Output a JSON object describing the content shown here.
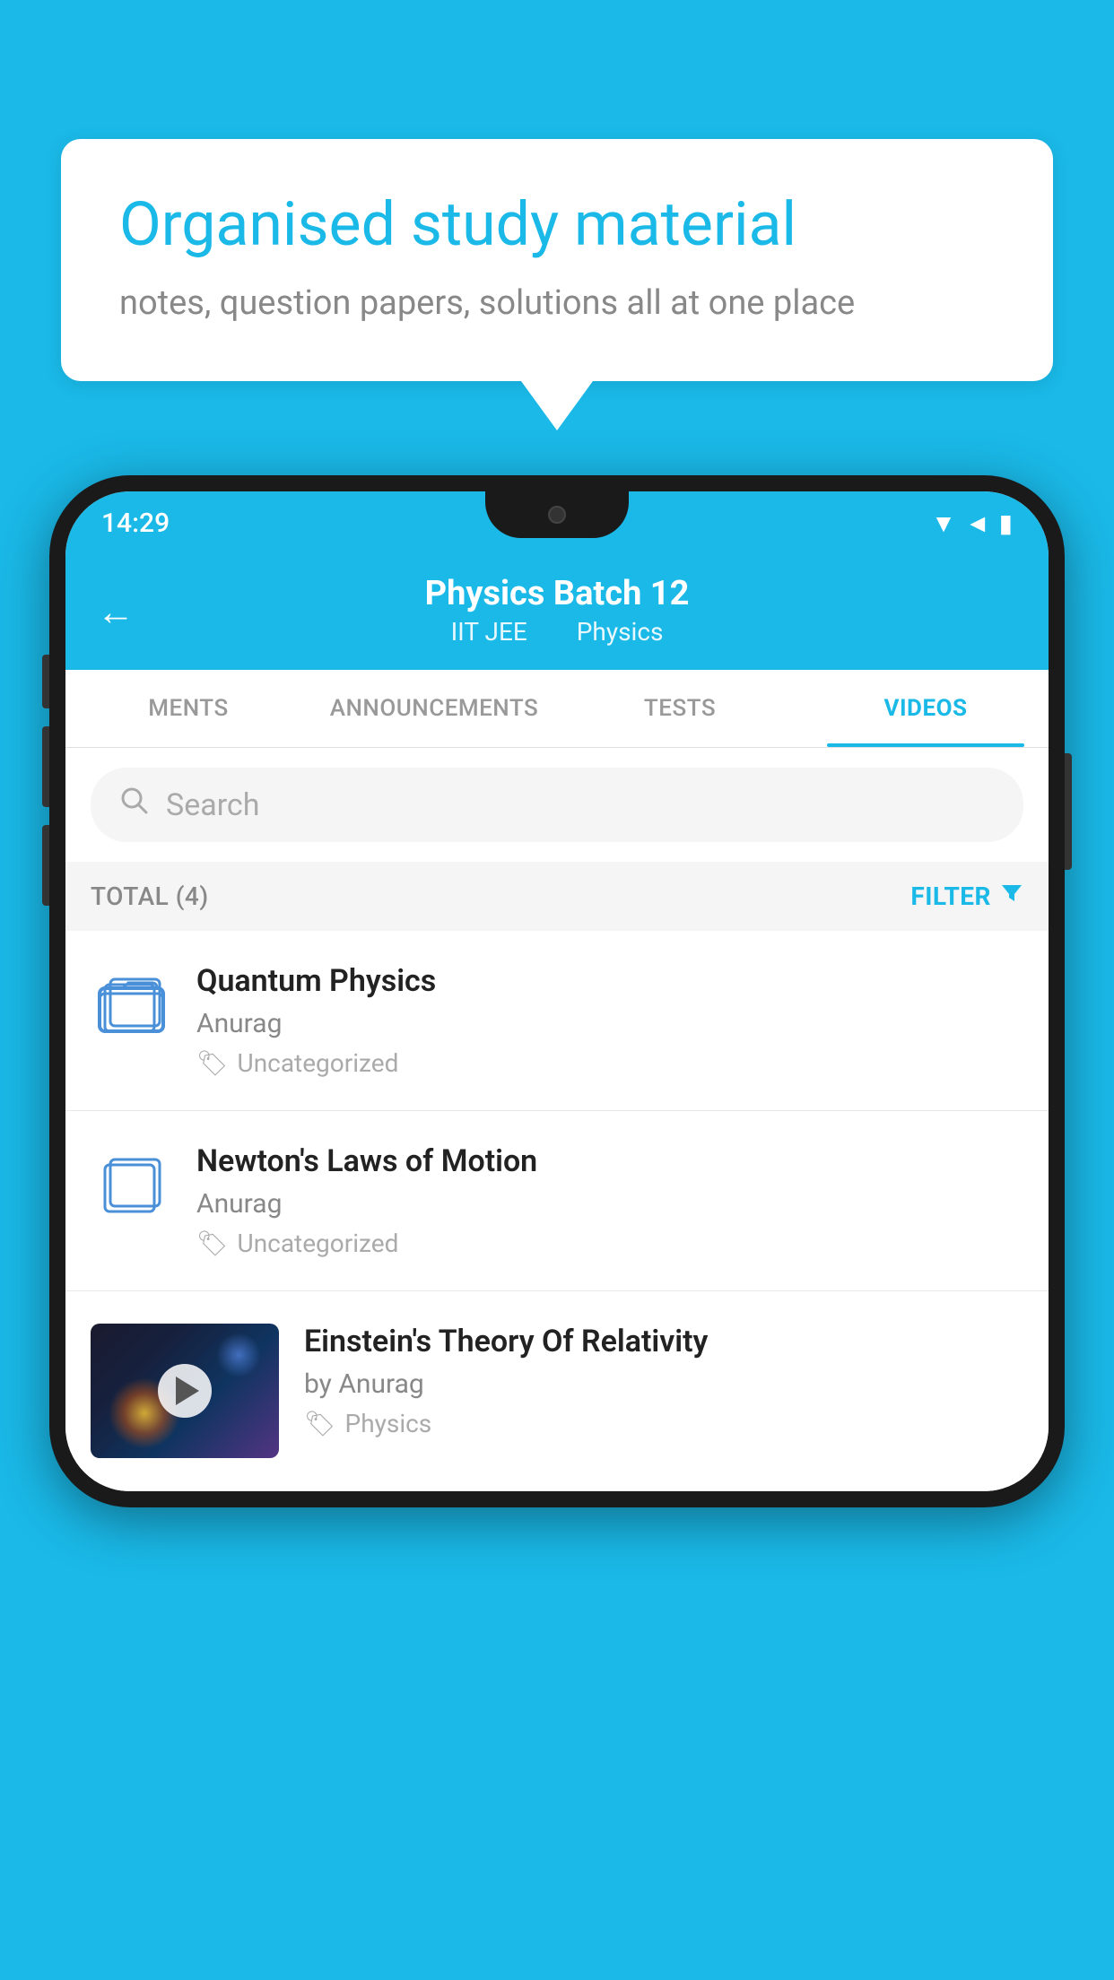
{
  "bubble": {
    "title": "Organised study material",
    "subtitle": "notes, question papers, solutions all at one place"
  },
  "phone": {
    "statusBar": {
      "time": "14:29"
    },
    "header": {
      "title": "Physics Batch 12",
      "subtitle1": "IIT JEE",
      "subtitle2": "Physics",
      "backLabel": "←"
    },
    "tabs": [
      {
        "label": "MENTS",
        "active": false
      },
      {
        "label": "ANNOUNCEMENTS",
        "active": false
      },
      {
        "label": "TESTS",
        "active": false
      },
      {
        "label": "VIDEOS",
        "active": true
      }
    ],
    "search": {
      "placeholder": "Search"
    },
    "filterRow": {
      "total": "TOTAL (4)",
      "filterLabel": "FILTER"
    },
    "videos": [
      {
        "title": "Quantum Physics",
        "author": "Anurag",
        "tag": "Uncategorized",
        "type": "folder"
      },
      {
        "title": "Newton's Laws of Motion",
        "author": "Anurag",
        "tag": "Uncategorized",
        "type": "folder"
      },
      {
        "title": "Einstein's Theory Of Relativity",
        "author": "by Anurag",
        "tag": "Physics",
        "type": "video"
      }
    ]
  }
}
